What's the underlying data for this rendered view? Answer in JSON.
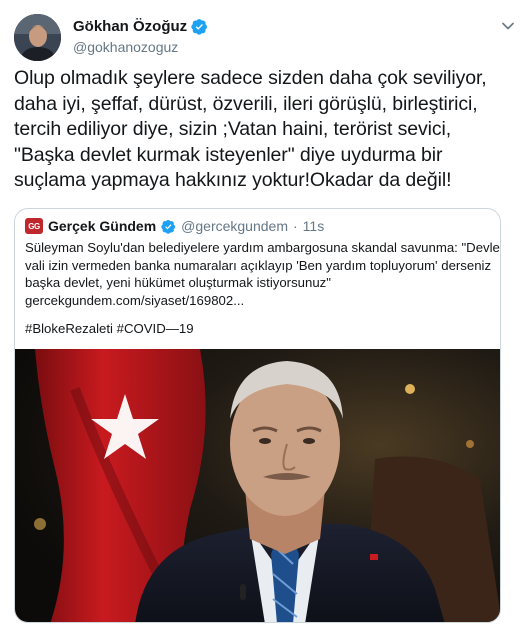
{
  "author": {
    "name": "Gökhan Özoğuz",
    "handle": "@gokhanozoguz"
  },
  "tweet": {
    "lines": [
      "Olup olmadık şeylere sadece sizden daha çok seviliyor,",
      "daha iyi, şeffaf, dürüst, özverili, ileri görüşlü, birleştirici,",
      "tercih ediliyor diye, sizin ;Vatan haini, terörist sevici,",
      "\"Başka devlet kurmak isteyenler\" diye uydurma bir",
      "suçlama yapmaya hakkınız yoktur!Okadar da değil!"
    ]
  },
  "quoted": {
    "logo_text": "GG",
    "name": "Gerçek Gündem",
    "handle": "@gercekgundem",
    "separator": "·",
    "time": "11s",
    "lines": [
      "Süleyman Soylu'dan belediyelere yardım ambargosuna skandal savunma: \"Devlet,",
      "vali izin vermeden banka numaraları açıklayıp 'Ben yardım topluyorum' derseniz",
      "başka devlet, yeni hükümet oluşturmak istiyorsunuz\"",
      "gercekgundem.com/siyaset/169802..."
    ],
    "hashtags": "#BlokeRezaleti #COVID—19"
  },
  "icons": {
    "verified": "verified-badge-icon",
    "caret": "chevron-down-icon"
  },
  "colors": {
    "accent": "#1da1f2",
    "secondary_text": "#657786",
    "border": "#ccd6dd"
  }
}
